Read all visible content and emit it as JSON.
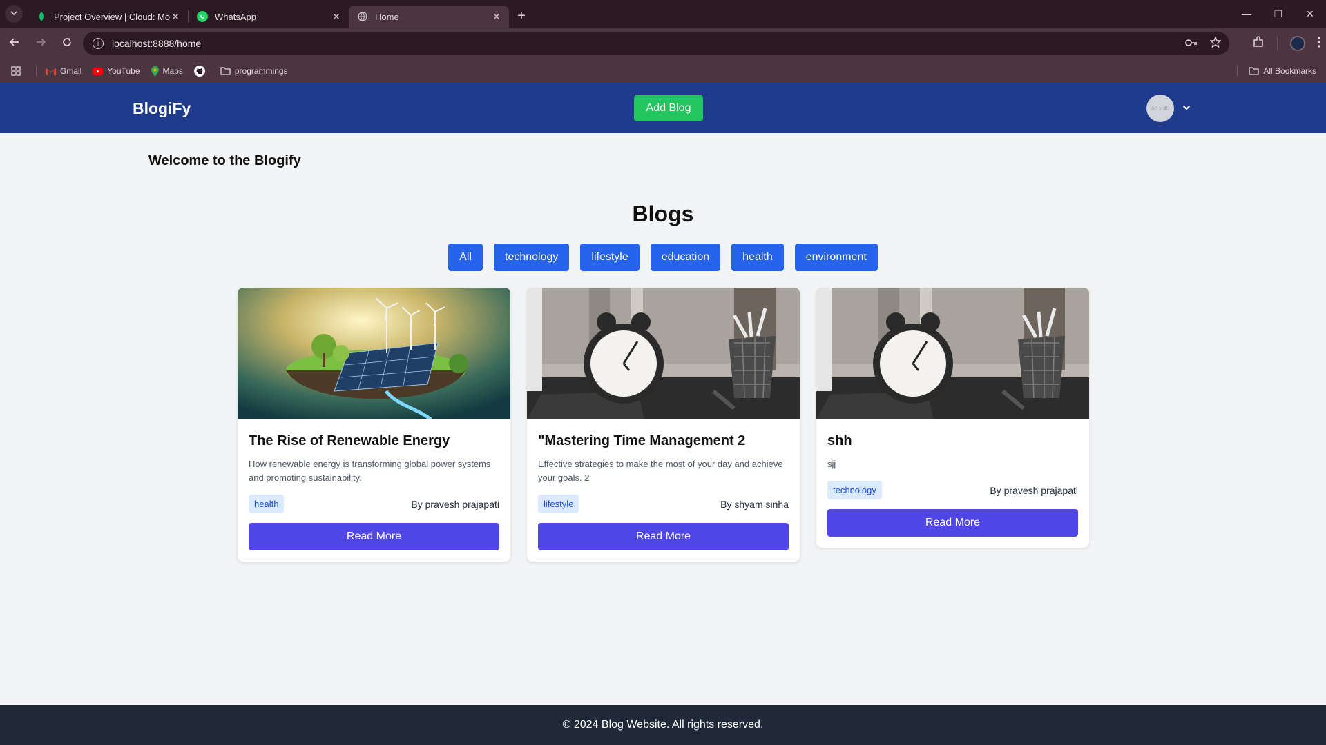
{
  "browser": {
    "tabs": [
      {
        "title": "Project Overview | Cloud: Mongo",
        "icon": "leaf-icon",
        "active": false
      },
      {
        "title": "WhatsApp",
        "icon": "whatsapp-icon",
        "active": false
      },
      {
        "title": "Home",
        "icon": "globe-icon",
        "active": true
      }
    ],
    "url": "localhost:8888/home",
    "bookmarks": [
      {
        "label": "Gmail",
        "icon": "gmail-icon"
      },
      {
        "label": "YouTube",
        "icon": "youtube-icon"
      },
      {
        "label": "Maps",
        "icon": "maps-icon"
      },
      {
        "label": "",
        "icon": "github-icon"
      },
      {
        "label": "programmings",
        "icon": "folder-icon"
      }
    ],
    "all_bookmarks": "All Bookmarks"
  },
  "header": {
    "brand": "BlogiFy",
    "add_blog": "Add Blog",
    "avatar_placeholder": "40 x 40",
    "colors": {
      "header_bg": "#1e3a8a",
      "add_button": "#22c55e"
    }
  },
  "main": {
    "welcome": "Welcome to the Blogify",
    "heading": "Blogs",
    "filters": [
      "All",
      "technology",
      "lifestyle",
      "education",
      "health",
      "environment"
    ],
    "read_more": "Read More",
    "posts": [
      {
        "title": "The Rise of Renewable Energy",
        "description": "How renewable energy is transforming global power systems and promoting sustainability.",
        "tag": "health",
        "author": "By pravesh prajapati",
        "image": "renewable-energy-image"
      },
      {
        "title": "\"Mastering Time Management 2",
        "description": "Effective strategies to make the most of your day and achieve your goals. 2",
        "tag": "lifestyle",
        "author": "By shyam sinha",
        "image": "alarm-clock-image"
      },
      {
        "title": "shh",
        "description": "sjj",
        "tag": "technology",
        "author": "By pravesh prajapati",
        "image": "alarm-clock-image"
      }
    ]
  },
  "footer": {
    "text": "© 2024 Blog Website. All rights reserved."
  }
}
